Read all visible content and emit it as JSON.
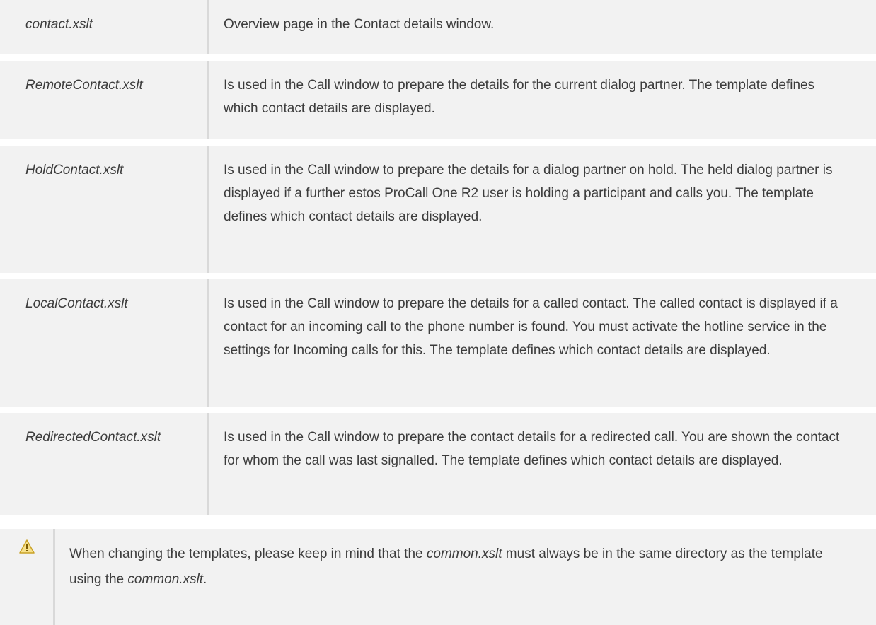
{
  "rows": [
    {
      "file": "contact.xslt",
      "description": "Overview page in the Contact details window."
    },
    {
      "file": "RemoteContact.xslt",
      "description": "Is used in the Call window to prepare the details for the current dialog partner. The template defines which contact details are displayed."
    },
    {
      "file": "HoldContact.xslt",
      "description": "Is used in the Call window to prepare the details for a dialog partner on hold. The held dialog partner is displayed if a further estos ProCall One R2 user is holding a participant and calls you. The template defines which contact details are displayed."
    },
    {
      "file": "LocalContact.xslt",
      "description": "Is used in the Call window to prepare the details for a called contact. The called contact is displayed if a contact for an incoming call to the phone number is found. You must activate the hotline service in the settings for Incoming calls for this. The template defines which contact details are displayed."
    },
    {
      "file": "RedirectedContact.xslt",
      "description": "Is used in the Call window to prepare the contact details for a redirected call. You are shown the contact for whom the call was last signalled. The template defines which contact details are displayed."
    }
  ],
  "note": {
    "icon": "warning-icon",
    "part1": "When changing the templates, please keep in mind that the ",
    "em1": "common.xslt",
    "part2": " must always be in the same directory as the template using the ",
    "em2": "common.xslt",
    "part3": "."
  }
}
